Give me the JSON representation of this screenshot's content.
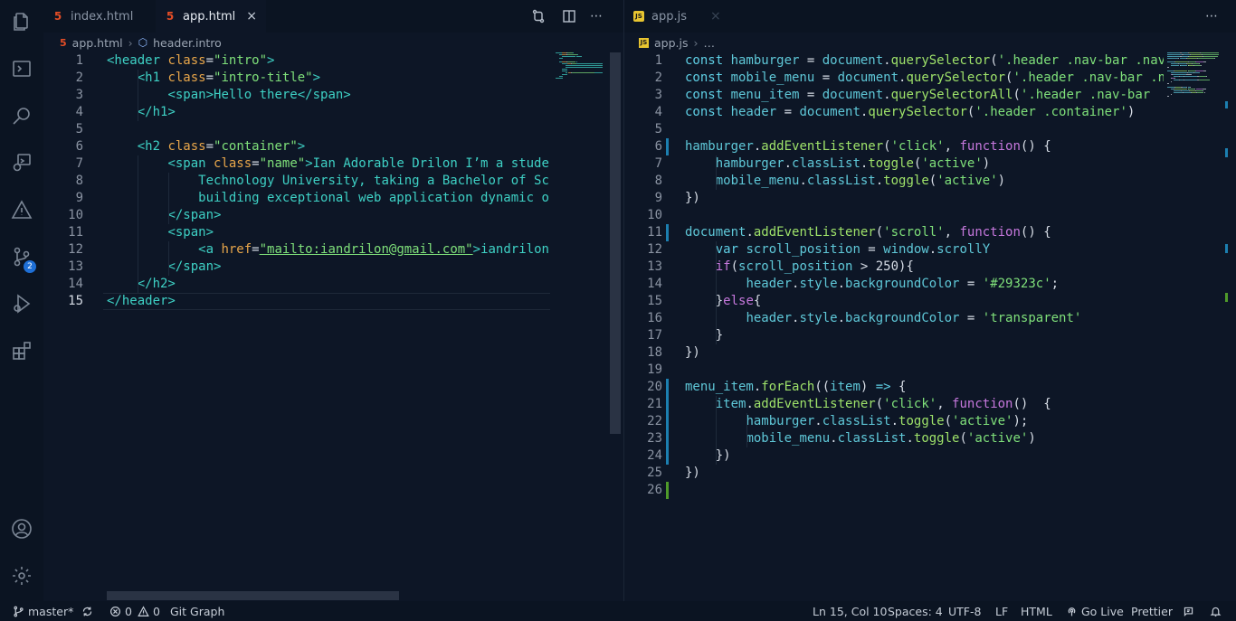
{
  "colors": {
    "background": "#0d1626",
    "accent": "#1e6fd6",
    "badge": "#1e6fd6"
  },
  "activity_bar": {
    "items": [
      {
        "icon": "files-icon"
      },
      {
        "icon": "terminal-icon"
      },
      {
        "icon": "search-icon"
      },
      {
        "icon": "debug-icon"
      },
      {
        "icon": "warning-icon"
      },
      {
        "icon": "source-control-icon",
        "badge": "2"
      },
      {
        "icon": "run-debug-icon"
      },
      {
        "icon": "extensions-icon"
      },
      {
        "icon": "account-icon"
      },
      {
        "icon": "settings-gear-icon"
      }
    ]
  },
  "left": {
    "tabs": [
      {
        "label": "index.html",
        "type": "html",
        "active": false
      },
      {
        "label": "app.html",
        "type": "html",
        "active": true,
        "close": "×"
      }
    ],
    "toolbar": {
      "more": "⋯"
    },
    "breadcrumb": {
      "file": "app.html",
      "symbol": "header.intro"
    },
    "cursor_line": 15,
    "line_numbers": [
      "1",
      "2",
      "3",
      "4",
      "5",
      "6",
      "7",
      "8",
      "9",
      "10",
      "11",
      "12",
      "13",
      "14",
      "15"
    ]
  },
  "right": {
    "tabs": [
      {
        "label": "app.js",
        "type": "js",
        "active": false,
        "close": "×"
      }
    ],
    "toolbar": {
      "more": "⋯"
    },
    "breadcrumb": {
      "file": "app.js",
      "rest": "…"
    },
    "line_numbers": [
      "1",
      "2",
      "3",
      "4",
      "5",
      "6",
      "7",
      "8",
      "9",
      "10",
      "11",
      "12",
      "13",
      "14",
      "15",
      "16",
      "17",
      "18",
      "19",
      "20",
      "21",
      "22",
      "23",
      "24",
      "25",
      "26"
    ]
  },
  "html_code": [
    [
      [
        "t-tag",
        "<header "
      ],
      [
        "t-attr",
        "class"
      ],
      [
        "t-pun",
        "="
      ],
      [
        "t-str",
        "\"intro\""
      ],
      [
        "t-tag",
        ">"
      ]
    ],
    [
      [
        "t-plain",
        "    "
      ],
      [
        "t-tag",
        "<h1 "
      ],
      [
        "t-attr",
        "class"
      ],
      [
        "t-pun",
        "="
      ],
      [
        "t-str",
        "\"intro-title\""
      ],
      [
        "t-tag",
        ">"
      ]
    ],
    [
      [
        "t-plain",
        "        "
      ],
      [
        "t-tag",
        "<span>"
      ],
      [
        "t-txt",
        "Hello there"
      ],
      [
        "t-tag",
        "</span>"
      ]
    ],
    [
      [
        "t-plain",
        "    "
      ],
      [
        "t-tag",
        "</h1>"
      ]
    ],
    [],
    [
      [
        "t-plain",
        "    "
      ],
      [
        "t-tag",
        "<h2 "
      ],
      [
        "t-attr",
        "class"
      ],
      [
        "t-pun",
        "="
      ],
      [
        "t-str",
        "\"container\""
      ],
      [
        "t-tag",
        ">"
      ]
    ],
    [
      [
        "t-plain",
        "        "
      ],
      [
        "t-tag",
        "<span "
      ],
      [
        "t-attr",
        "class"
      ],
      [
        "t-pun",
        "="
      ],
      [
        "t-str",
        "\"name\""
      ],
      [
        "t-tag",
        ">"
      ],
      [
        "t-txt",
        "Ian Adorable Drilon I’m a stude"
      ]
    ],
    [
      [
        "t-plain",
        "            "
      ],
      [
        "t-txt",
        "Technology University, taking a Bachelor of Sc"
      ]
    ],
    [
      [
        "t-plain",
        "            "
      ],
      [
        "t-txt",
        "building exceptional web application dynamic o"
      ]
    ],
    [
      [
        "t-plain",
        "        "
      ],
      [
        "t-tag",
        "</span>"
      ]
    ],
    [
      [
        "t-plain",
        "        "
      ],
      [
        "t-tag",
        "<span>"
      ]
    ],
    [
      [
        "t-plain",
        "            "
      ],
      [
        "t-tag",
        "<a "
      ],
      [
        "t-attr",
        "href"
      ],
      [
        "t-pun",
        "="
      ],
      [
        "t-link",
        "\"mailto:iandrilon@gmail.com\""
      ],
      [
        "t-tag",
        ">"
      ],
      [
        "t-txt",
        "iandrilon"
      ]
    ],
    [
      [
        "t-plain",
        "        "
      ],
      [
        "t-tag",
        "</span>"
      ]
    ],
    [
      [
        "t-plain",
        "    "
      ],
      [
        "t-tag",
        "</h2>"
      ]
    ],
    [
      [
        "t-tag",
        "</header>"
      ]
    ]
  ],
  "js_code": [
    [
      [
        "t-kw",
        "const "
      ],
      [
        "t-var",
        "hamburger "
      ],
      [
        "t-pun",
        "= "
      ],
      [
        "t-var",
        "document"
      ],
      [
        "t-pun",
        "."
      ],
      [
        "t-fn",
        "querySelector"
      ],
      [
        "t-pun",
        "("
      ],
      [
        "t-str",
        "'.header .nav-bar .nav"
      ]
    ],
    [
      [
        "t-kw",
        "const "
      ],
      [
        "t-var",
        "mobile_menu "
      ],
      [
        "t-pun",
        "= "
      ],
      [
        "t-var",
        "document"
      ],
      [
        "t-pun",
        "."
      ],
      [
        "t-fn",
        "querySelector"
      ],
      [
        "t-pun",
        "("
      ],
      [
        "t-str",
        "'.header .nav-bar .n"
      ]
    ],
    [
      [
        "t-kw",
        "const "
      ],
      [
        "t-var",
        "menu_item "
      ],
      [
        "t-pun",
        "= "
      ],
      [
        "t-var",
        "document"
      ],
      [
        "t-pun",
        "."
      ],
      [
        "t-fn",
        "querySelectorAll"
      ],
      [
        "t-pun",
        "("
      ],
      [
        "t-str",
        "'.header .nav-bar "
      ]
    ],
    [
      [
        "t-kw",
        "const "
      ],
      [
        "t-var",
        "header "
      ],
      [
        "t-pun",
        "= "
      ],
      [
        "t-var",
        "document"
      ],
      [
        "t-pun",
        "."
      ],
      [
        "t-fn",
        "querySelector"
      ],
      [
        "t-pun",
        "("
      ],
      [
        "t-str",
        "'.header .container'"
      ],
      [
        "t-pun",
        ")"
      ]
    ],
    [],
    [
      [
        "t-var",
        "hamburger"
      ],
      [
        "t-pun",
        "."
      ],
      [
        "t-fn",
        "addEventListener"
      ],
      [
        "t-pun",
        "("
      ],
      [
        "t-str",
        "'click'"
      ],
      [
        "t-pun",
        ", "
      ],
      [
        "t-purple",
        "function"
      ],
      [
        "t-pun",
        "() {"
      ]
    ],
    [
      [
        "t-plain",
        "    "
      ],
      [
        "t-var",
        "hamburger"
      ],
      [
        "t-pun",
        "."
      ],
      [
        "t-var",
        "classList"
      ],
      [
        "t-pun",
        "."
      ],
      [
        "t-fn",
        "toggle"
      ],
      [
        "t-pun",
        "("
      ],
      [
        "t-str",
        "'active'"
      ],
      [
        "t-pun",
        ")"
      ]
    ],
    [
      [
        "t-plain",
        "    "
      ],
      [
        "t-var",
        "mobile_menu"
      ],
      [
        "t-pun",
        "."
      ],
      [
        "t-var",
        "classList"
      ],
      [
        "t-pun",
        "."
      ],
      [
        "t-fn",
        "toggle"
      ],
      [
        "t-pun",
        "("
      ],
      [
        "t-str",
        "'active'"
      ],
      [
        "t-pun",
        ")"
      ]
    ],
    [
      [
        "t-pun",
        "})"
      ]
    ],
    [],
    [
      [
        "t-var",
        "document"
      ],
      [
        "t-pun",
        "."
      ],
      [
        "t-fn",
        "addEventListener"
      ],
      [
        "t-pun",
        "("
      ],
      [
        "t-str",
        "'scroll'"
      ],
      [
        "t-pun",
        ", "
      ],
      [
        "t-purple",
        "function"
      ],
      [
        "t-pun",
        "() {"
      ]
    ],
    [
      [
        "t-plain",
        "    "
      ],
      [
        "t-kw",
        "var "
      ],
      [
        "t-var",
        "scroll_position "
      ],
      [
        "t-pun",
        "= "
      ],
      [
        "t-var",
        "window"
      ],
      [
        "t-pun",
        "."
      ],
      [
        "t-var",
        "scrollY"
      ]
    ],
    [
      [
        "t-plain",
        "    "
      ],
      [
        "t-purple",
        "if"
      ],
      [
        "t-pun",
        "("
      ],
      [
        "t-var",
        "scroll_position "
      ],
      [
        "t-pun",
        "> 250){"
      ]
    ],
    [
      [
        "t-plain",
        "        "
      ],
      [
        "t-var",
        "header"
      ],
      [
        "t-pun",
        "."
      ],
      [
        "t-var",
        "style"
      ],
      [
        "t-pun",
        "."
      ],
      [
        "t-var",
        "backgroundColor "
      ],
      [
        "t-pun",
        "= "
      ],
      [
        "t-str",
        "'#29323c'"
      ],
      [
        "t-pun",
        ";"
      ]
    ],
    [
      [
        "t-plain",
        "    "
      ],
      [
        "t-pun",
        "}"
      ],
      [
        "t-purple",
        "else"
      ],
      [
        "t-pun",
        "{"
      ]
    ],
    [
      [
        "t-plain",
        "        "
      ],
      [
        "t-var",
        "header"
      ],
      [
        "t-pun",
        "."
      ],
      [
        "t-var",
        "style"
      ],
      [
        "t-pun",
        "."
      ],
      [
        "t-var",
        "backgroundColor "
      ],
      [
        "t-pun",
        "= "
      ],
      [
        "t-str",
        "'transparent'"
      ]
    ],
    [
      [
        "t-plain",
        "    "
      ],
      [
        "t-pun",
        "}"
      ]
    ],
    [
      [
        "t-pun",
        "})"
      ]
    ],
    [],
    [
      [
        "t-var",
        "menu_item"
      ],
      [
        "t-pun",
        "."
      ],
      [
        "t-fn",
        "forEach"
      ],
      [
        "t-pun",
        "(("
      ],
      [
        "t-var",
        "item"
      ],
      [
        "t-pun",
        ") "
      ],
      [
        "t-kw",
        "=> "
      ],
      [
        "t-pun",
        "{"
      ]
    ],
    [
      [
        "t-plain",
        "    "
      ],
      [
        "t-var",
        "item"
      ],
      [
        "t-pun",
        "."
      ],
      [
        "t-fn",
        "addEventListener"
      ],
      [
        "t-pun",
        "("
      ],
      [
        "t-str",
        "'click'"
      ],
      [
        "t-pun",
        ", "
      ],
      [
        "t-purple",
        "function"
      ],
      [
        "t-pun",
        "()  {"
      ]
    ],
    [
      [
        "t-plain",
        "        "
      ],
      [
        "t-var",
        "hamburger"
      ],
      [
        "t-pun",
        "."
      ],
      [
        "t-var",
        "classList"
      ],
      [
        "t-pun",
        "."
      ],
      [
        "t-fn",
        "toggle"
      ],
      [
        "t-pun",
        "("
      ],
      [
        "t-str",
        "'active'"
      ],
      [
        "t-pun",
        ");"
      ]
    ],
    [
      [
        "t-plain",
        "        "
      ],
      [
        "t-var",
        "mobile_menu"
      ],
      [
        "t-pun",
        "."
      ],
      [
        "t-var",
        "classList"
      ],
      [
        "t-pun",
        "."
      ],
      [
        "t-fn",
        "toggle"
      ],
      [
        "t-pun",
        "("
      ],
      [
        "t-str",
        "'active'"
      ],
      [
        "t-pun",
        ")"
      ]
    ],
    [
      [
        "t-plain",
        "    "
      ],
      [
        "t-pun",
        "})"
      ]
    ],
    [
      [
        "t-pun",
        "})"
      ]
    ],
    []
  ],
  "status": {
    "branch": "master*",
    "errors": "0",
    "warnings": "0",
    "git_graph": "Git Graph",
    "position": "Ln 15, Col 10",
    "spaces": "Spaces: 4",
    "encoding": "UTF-8",
    "eol": "LF",
    "language": "HTML",
    "go_live": "Go Live",
    "prettier": "Prettier"
  }
}
